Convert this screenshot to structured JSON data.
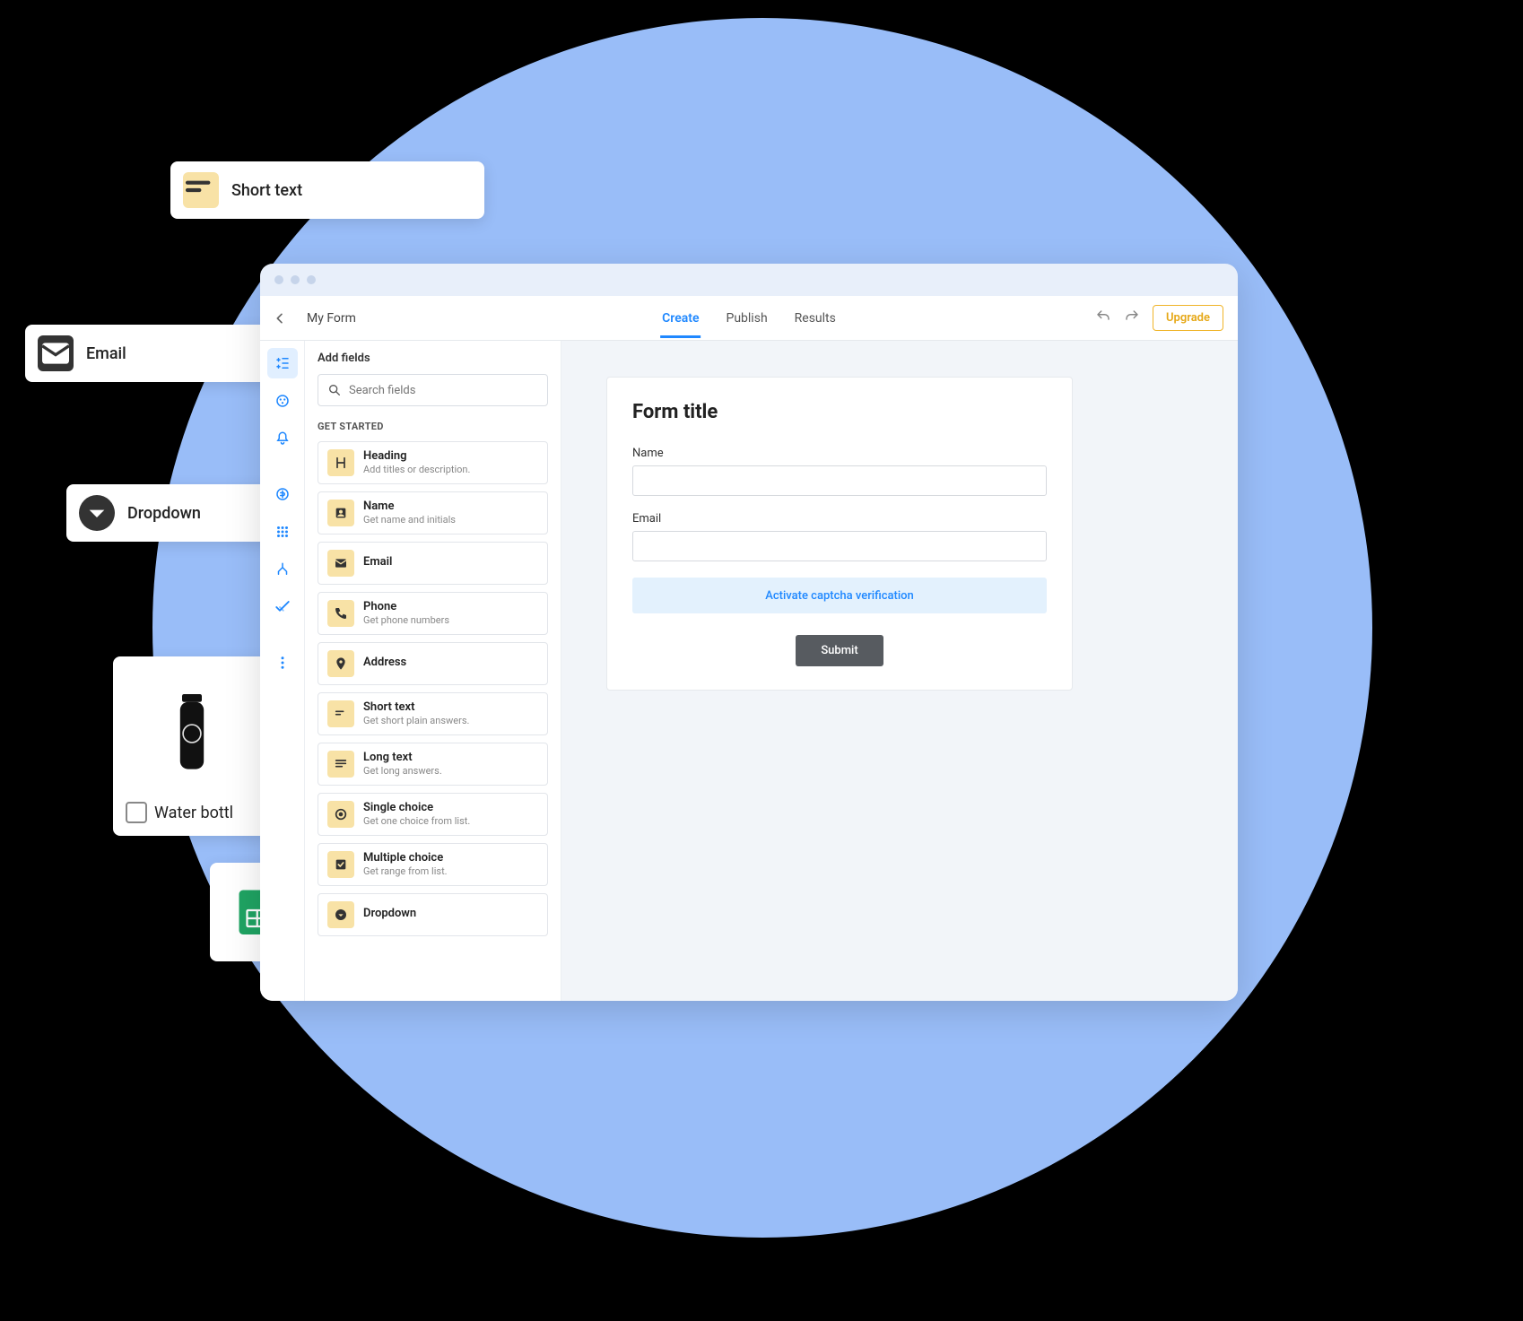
{
  "float": {
    "short_text": "Short text",
    "email": "Email",
    "dropdown": "Dropdown",
    "product_label": "Water bottl"
  },
  "header": {
    "breadcrumb": "My Form",
    "tabs": [
      "Create",
      "Publish",
      "Results"
    ],
    "upgrade": "Upgrade"
  },
  "panel": {
    "title": "Add fields",
    "search_placeholder": "Search fields",
    "section": "GET STARTED",
    "fields": [
      {
        "name": "Heading",
        "desc": "Add titles or description."
      },
      {
        "name": "Name",
        "desc": "Get name and initials"
      },
      {
        "name": "Email",
        "desc": ""
      },
      {
        "name": "Phone",
        "desc": "Get phone numbers"
      },
      {
        "name": "Address",
        "desc": ""
      },
      {
        "name": "Short text",
        "desc": "Get short plain answers."
      },
      {
        "name": "Long text",
        "desc": "Get long answers."
      },
      {
        "name": "Single choice",
        "desc": "Get one choice from list."
      },
      {
        "name": "Multiple choice",
        "desc": "Get range from list."
      },
      {
        "name": "Dropdown",
        "desc": ""
      }
    ]
  },
  "form": {
    "title": "Form title",
    "name_label": "Name",
    "email_label": "Email",
    "captcha": "Activate captcha verification",
    "submit": "Submit"
  }
}
